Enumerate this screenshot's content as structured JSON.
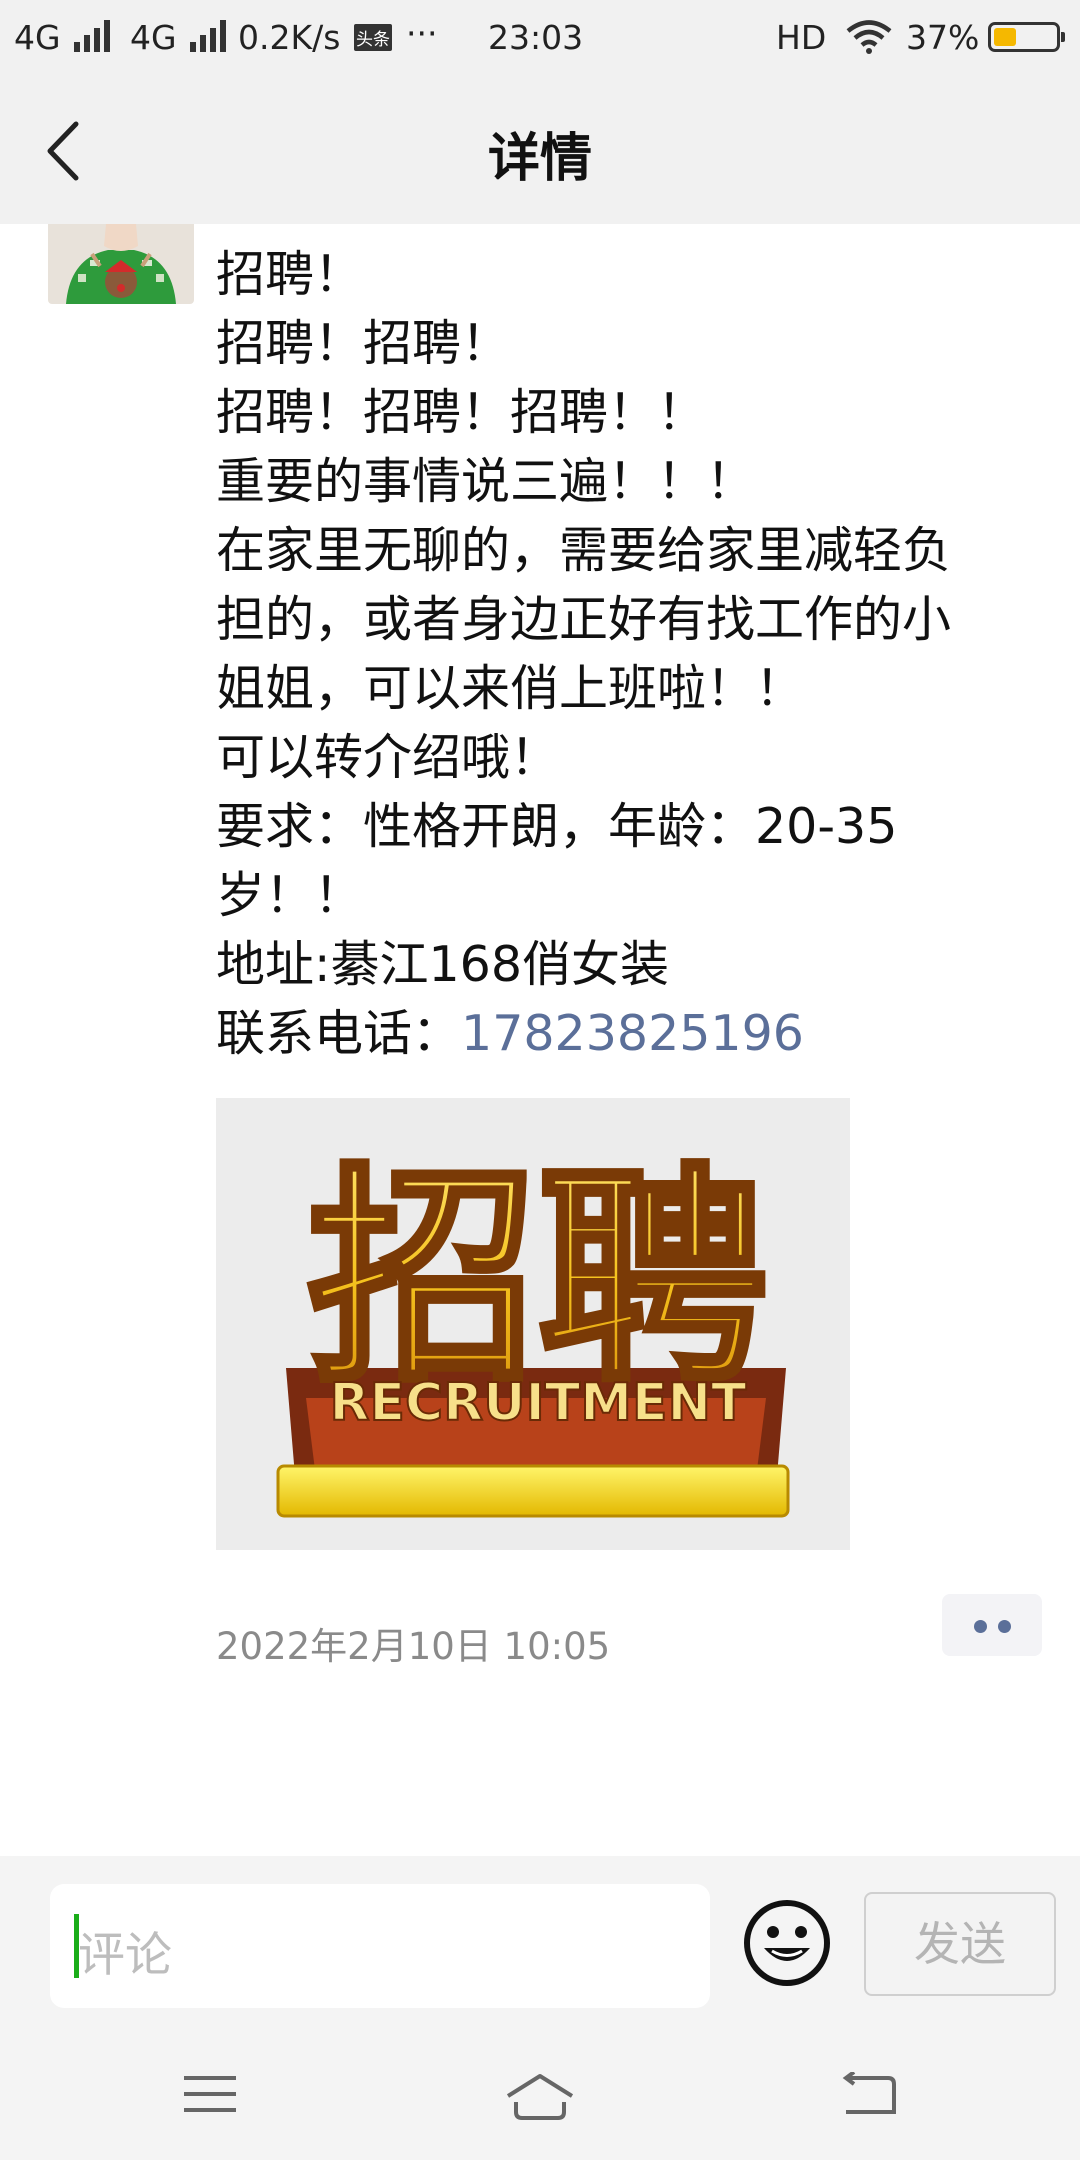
{
  "status_bar": {
    "network1": "4G",
    "network2": "4G",
    "speed": "0.2K/s",
    "app_badge": "头条",
    "more": "···",
    "time": "23:03",
    "hd": "HD",
    "battery_percent": "37%",
    "battery_level": 0.37,
    "battery_color": "#f5b800"
  },
  "header": {
    "title": "详情"
  },
  "post": {
    "lines": [
      "招聘！",
      "招聘！招聘！",
      "招聘！招聘！招聘！！",
      "重要的事情说三遍！！！",
      "在家里无聊的，需要给家里减轻负",
      "担的，或者身边正好有找工作的小",
      "姐姐，可以来俏上班啦！！",
      "可以转介绍哦！",
      "要求：性格开朗，年龄：20-35",
      "岁！！",
      "地址:綦江168俏女装"
    ],
    "phone_label": "联系电话：",
    "phone_number": "17823825196",
    "image_title": "招聘",
    "image_subtitle": "RECRUITMENT",
    "timestamp": "2022年2月10日 10:05"
  },
  "comment": {
    "placeholder": "评论",
    "send_label": "发送"
  },
  "colors": {
    "link": "#5b6f99",
    "caret": "#1aad19"
  }
}
